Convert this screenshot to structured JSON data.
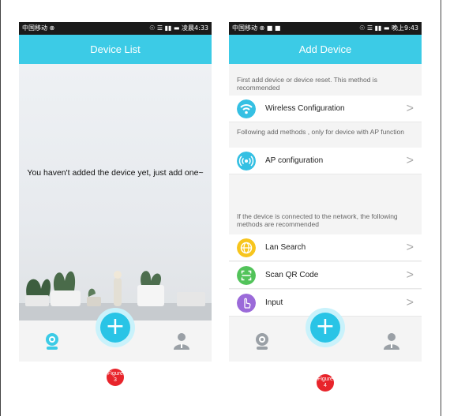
{
  "left_phone": {
    "status_left": "中国移动 ⊗",
    "status_right": "☉ ☰ ▮▮ ▬ 凌晨4:33",
    "title": "Device List",
    "empty_message": "You haven't added the device yet, just add one~",
    "tabs": {
      "devices_icon": "camera-icon",
      "add_icon": "plus-icon",
      "profile_icon": "user-icon"
    },
    "figure_label": "Figure 3"
  },
  "right_phone": {
    "status_left": "中国移动 ⊗ ■ ■",
    "status_right": "☉ ☰ ▮▮ ▬ 晚上9:43",
    "title": "Add Device",
    "note_1": "First add device or device reset. This method is recommended",
    "note_2": "Following add methods , only for device with AP function",
    "note_3": "If the device is connected to the network, the following methods are recommended",
    "items": [
      {
        "label": "Wireless Configuration",
        "icon": "wifi-icon",
        "color": "#35c0e3"
      },
      {
        "label": "AP configuration",
        "icon": "broadcast-icon",
        "color": "#35c0e3"
      },
      {
        "label": "Lan Search",
        "icon": "globe-icon",
        "color": "#f7c51d"
      },
      {
        "label": "Scan QR Code",
        "icon": "qr-scan-icon",
        "color": "#52c35a"
      },
      {
        "label": "Input",
        "icon": "hand-pointer-icon",
        "color": "#9b6ad9"
      }
    ],
    "chevron": ">",
    "figure_label": "Figure 4"
  },
  "colors": {
    "accent": "#3ccbe6",
    "badge": "#e8242b"
  }
}
